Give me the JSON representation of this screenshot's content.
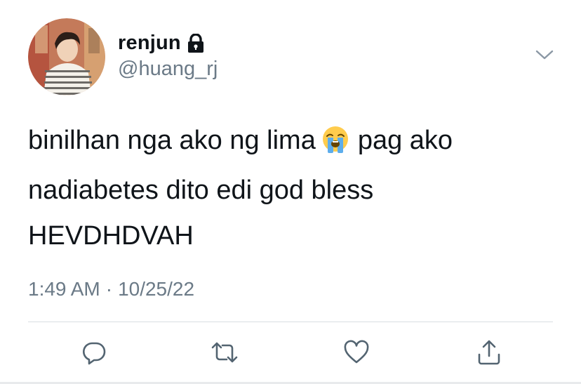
{
  "user": {
    "display_name": "renjun",
    "handle": "@huang_rj",
    "protected": true,
    "avatar": "profile-photo"
  },
  "tweet": {
    "line1_before_emoji": "binilhan nga ako ng lima",
    "emoji": "loudly-crying-face",
    "line1_after_emoji": "pag ako",
    "line2": "nadiabetes dito edi god bless",
    "line3": "HEVDHDVAH"
  },
  "meta": {
    "time": "1:49 AM",
    "separator": "·",
    "date": "10/25/22"
  },
  "icons": {
    "more": "chevron-down-icon",
    "reply": "reply-icon",
    "retweet": "retweet-icon",
    "like": "heart-icon",
    "share": "share-icon",
    "lock": "lock-icon"
  },
  "colors": {
    "text": "#0f1419",
    "secondary": "#6b7a87",
    "icon": "#536471",
    "divider": "#d9dde1"
  }
}
